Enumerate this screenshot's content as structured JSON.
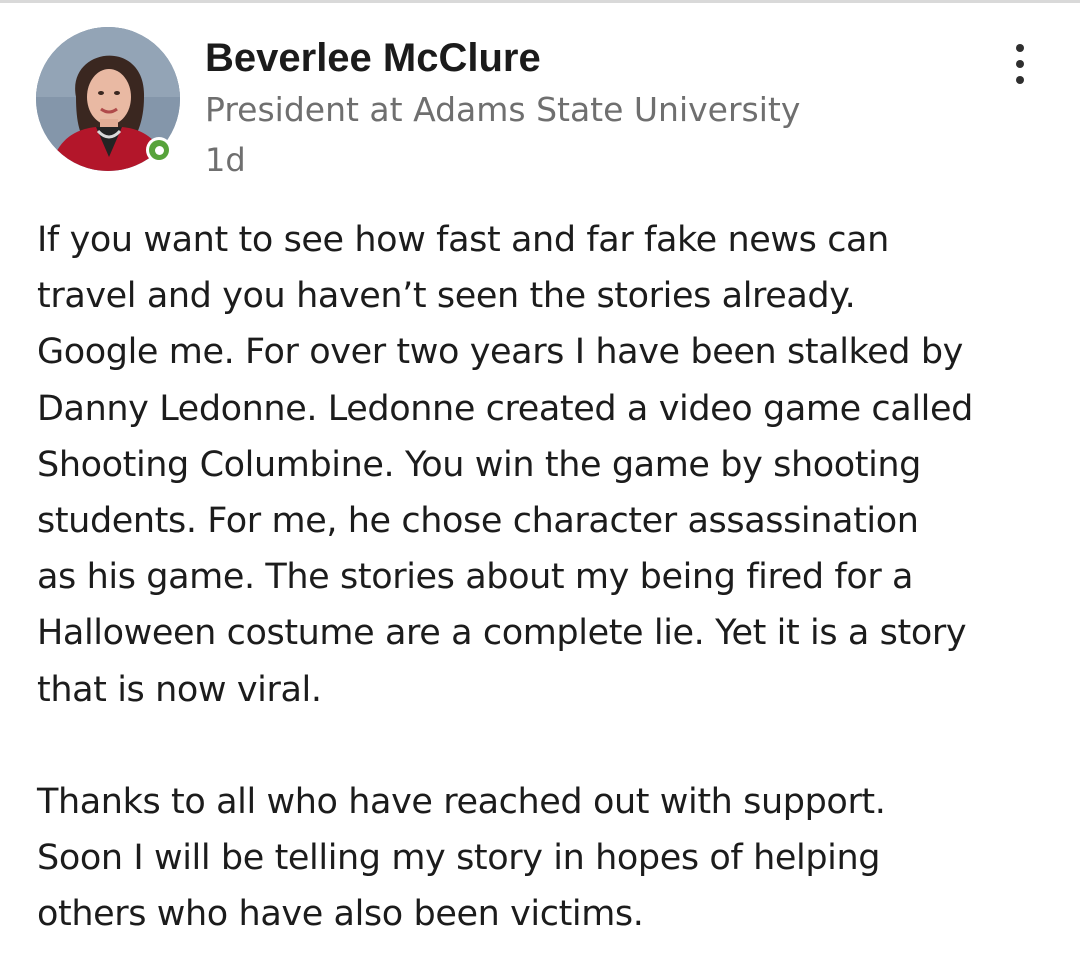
{
  "author": {
    "name": "Beverlee McClure",
    "headline": "President at Adams State University",
    "time": "1d",
    "online": true,
    "presence_color": "#57a33a"
  },
  "icons": {
    "more": "more-vertical-icon",
    "presence": "online-status-icon"
  },
  "post": {
    "paragraph1": [
      "If you want to see how fast and far fake news can",
      "travel and you haven’t seen the stories already.",
      "Google me. For over two years I have been stalked by",
      "Danny Ledonne. Ledonne created a video game called",
      "Shooting Columbine. You win the game by shooting",
      "students. For me, he chose character assassination",
      "as his game. The stories about my being fired for a",
      "Halloween costume are a complete lie. Yet it is a story",
      "that is now viral."
    ],
    "paragraph2": [
      "Thanks to all who have reached out with support.",
      "Soon I will be telling my story in hopes of helping",
      "others who have also been victims."
    ]
  }
}
